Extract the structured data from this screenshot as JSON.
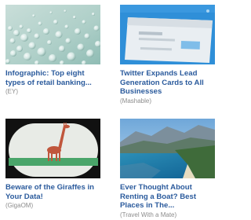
{
  "articles": [
    {
      "headline": "Infographic: Top eight types of retail banking...",
      "source": "(EY)",
      "thumbnail": "water-droplets-image"
    },
    {
      "headline": "Twitter Expands Lead Generation Cards to All Businesses",
      "source": "(Mashable)",
      "thumbnail": "blue-card-image"
    },
    {
      "headline": "Beware of the Giraffes in Your Data!",
      "source": "(GigaOM)",
      "thumbnail": "giraffe-binoculars-image"
    },
    {
      "headline": "Ever Thought About Renting a Boat? Best Places in The...",
      "source": "(Travel With a Mate)",
      "thumbnail": "coastal-bay-image"
    }
  ],
  "colors": {
    "headline": "#2a5a9c",
    "source": "#8c8c8c"
  }
}
